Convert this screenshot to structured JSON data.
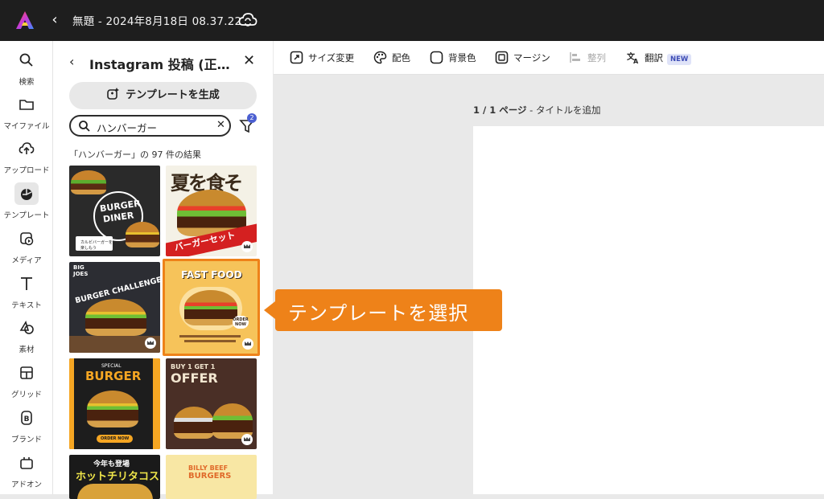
{
  "topbar": {
    "doc_title": "無題 - 2024年8月18日 08.37.22",
    "logo_icon": "adobe-express-logo",
    "back_icon": "chevron-left-icon",
    "cloud_icon": "cloud-sync-icon"
  },
  "rail": {
    "items": [
      {
        "label": "検索",
        "icon": "search-icon"
      },
      {
        "label": "マイファイル",
        "icon": "folder-icon"
      },
      {
        "label": "アップロード",
        "icon": "upload-icon"
      },
      {
        "label": "テンプレート",
        "icon": "template-icon",
        "active": true
      },
      {
        "label": "メディア",
        "icon": "media-icon"
      },
      {
        "label": "テキスト",
        "icon": "text-icon"
      },
      {
        "label": "素材",
        "icon": "elements-icon"
      },
      {
        "label": "グリッド",
        "icon": "grid-icon"
      },
      {
        "label": "ブランド",
        "icon": "brand-icon"
      },
      {
        "label": "アドオン",
        "icon": "addon-icon"
      }
    ]
  },
  "panel": {
    "title": "Instagram 投稿 (正…",
    "generate_label": "テンプレートを生成",
    "search_value": "ハンバーガー",
    "filter_count": "2",
    "results_text": "「ハンバーガー」の 97 件の結果",
    "templates": [
      {
        "name": "burger-diner",
        "lines": [
          "BURGER",
          "DINER"
        ],
        "sub": "カルビバーガーを楽しもう"
      },
      {
        "name": "summer-burger-set",
        "lines": [
          "夏を食そ",
          "バーガーセット"
        ]
      },
      {
        "name": "burger-challenge",
        "lines": [
          "BIG",
          "JOES",
          "BURGER CHALLENGE"
        ]
      },
      {
        "name": "fast-food",
        "lines": [
          "FAST FOOD",
          "ORDER NOW"
        ]
      },
      {
        "name": "special-burger",
        "lines": [
          "SPECIAL",
          "BURGER",
          "ORDER NOW"
        ]
      },
      {
        "name": "buy-one-offer",
        "lines": [
          "BUY 1 GET 1",
          "OFFER"
        ]
      },
      {
        "name": "hot-chili-tacos",
        "lines": [
          "今年も登場",
          "ホットチリタコス"
        ]
      },
      {
        "name": "billy-beef-burgers",
        "lines": [
          "BILLY BEEF",
          "BURGERS"
        ]
      }
    ]
  },
  "toolbar": {
    "resize": "サイズ変更",
    "colors": "配色",
    "background": "背景色",
    "margin": "マージン",
    "align": "整列",
    "translate": "翻訳",
    "new_badge": "NEW"
  },
  "canvas": {
    "page_num": "1 / 1 ページ",
    "page_title_hint": " - タイトルを追加"
  },
  "callout": {
    "text": "テンプレートを選択",
    "color": "#ee8219"
  },
  "colors": {
    "topbar": "#1e1e1e",
    "accent": "#4b5fd1",
    "selected_border": "#ee8219"
  }
}
